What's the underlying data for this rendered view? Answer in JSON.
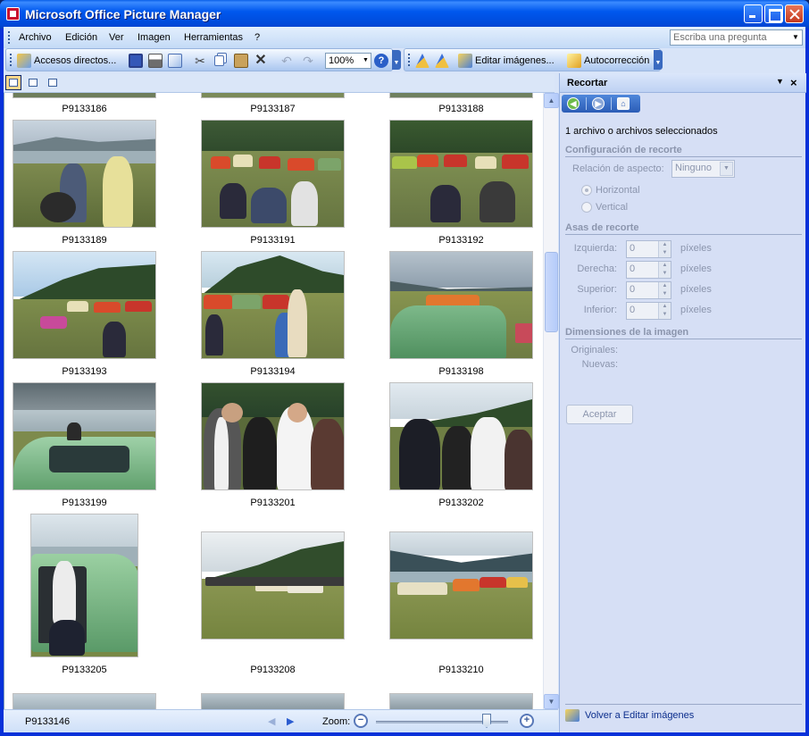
{
  "window": {
    "title": "Microsoft Office Picture Manager"
  },
  "menu": {
    "items": [
      "Archivo",
      "Edición",
      "Ver",
      "Imagen",
      "Herramientas",
      "?"
    ],
    "ask_placeholder": "Escriba una pregunta"
  },
  "toolbar": {
    "shortcuts_label": "Accesos directos...",
    "zoom_value": "100%",
    "edit_images_label": "Editar imágenes...",
    "autocorrect_label": "Autocorrección"
  },
  "thumbnails": [
    {
      "name": "P9133186"
    },
    {
      "name": "P9133187"
    },
    {
      "name": "P9133188"
    },
    {
      "name": "P9133189"
    },
    {
      "name": "P9133191"
    },
    {
      "name": "P9133192"
    },
    {
      "name": "P9133193"
    },
    {
      "name": "P9133194"
    },
    {
      "name": "P9133198"
    },
    {
      "name": "P9133199"
    },
    {
      "name": "P9133201"
    },
    {
      "name": "P9133202"
    },
    {
      "name": "P9133205"
    },
    {
      "name": "P9133208"
    },
    {
      "name": "P9133210"
    }
  ],
  "status": {
    "current_file": "P9133146",
    "zoom_label": "Zoom:"
  },
  "pane": {
    "title": "Recortar",
    "selection_text": "1 archivo o archivos seleccionados",
    "section_crop_settings": "Configuración de recorte",
    "aspect_ratio_label": "Relación de aspecto:",
    "aspect_ratio_value": "Ninguno",
    "horizontal_label": "Horizontal",
    "vertical_label": "Vertical",
    "section_crop_handles": "Asas de recorte",
    "left_label": "Izquierda:",
    "right_label": "Derecha:",
    "top_label": "Superior:",
    "bottom_label": "Inferior:",
    "left_value": "0",
    "right_value": "0",
    "top_value": "0",
    "bottom_value": "0",
    "unit_label": "píxeles",
    "section_dimensions": "Dimensiones de la imagen",
    "originals_label": "Originales:",
    "new_label": "Nuevas:",
    "accept_label": "Aceptar",
    "back_link": "Volver a Editar imágenes"
  }
}
